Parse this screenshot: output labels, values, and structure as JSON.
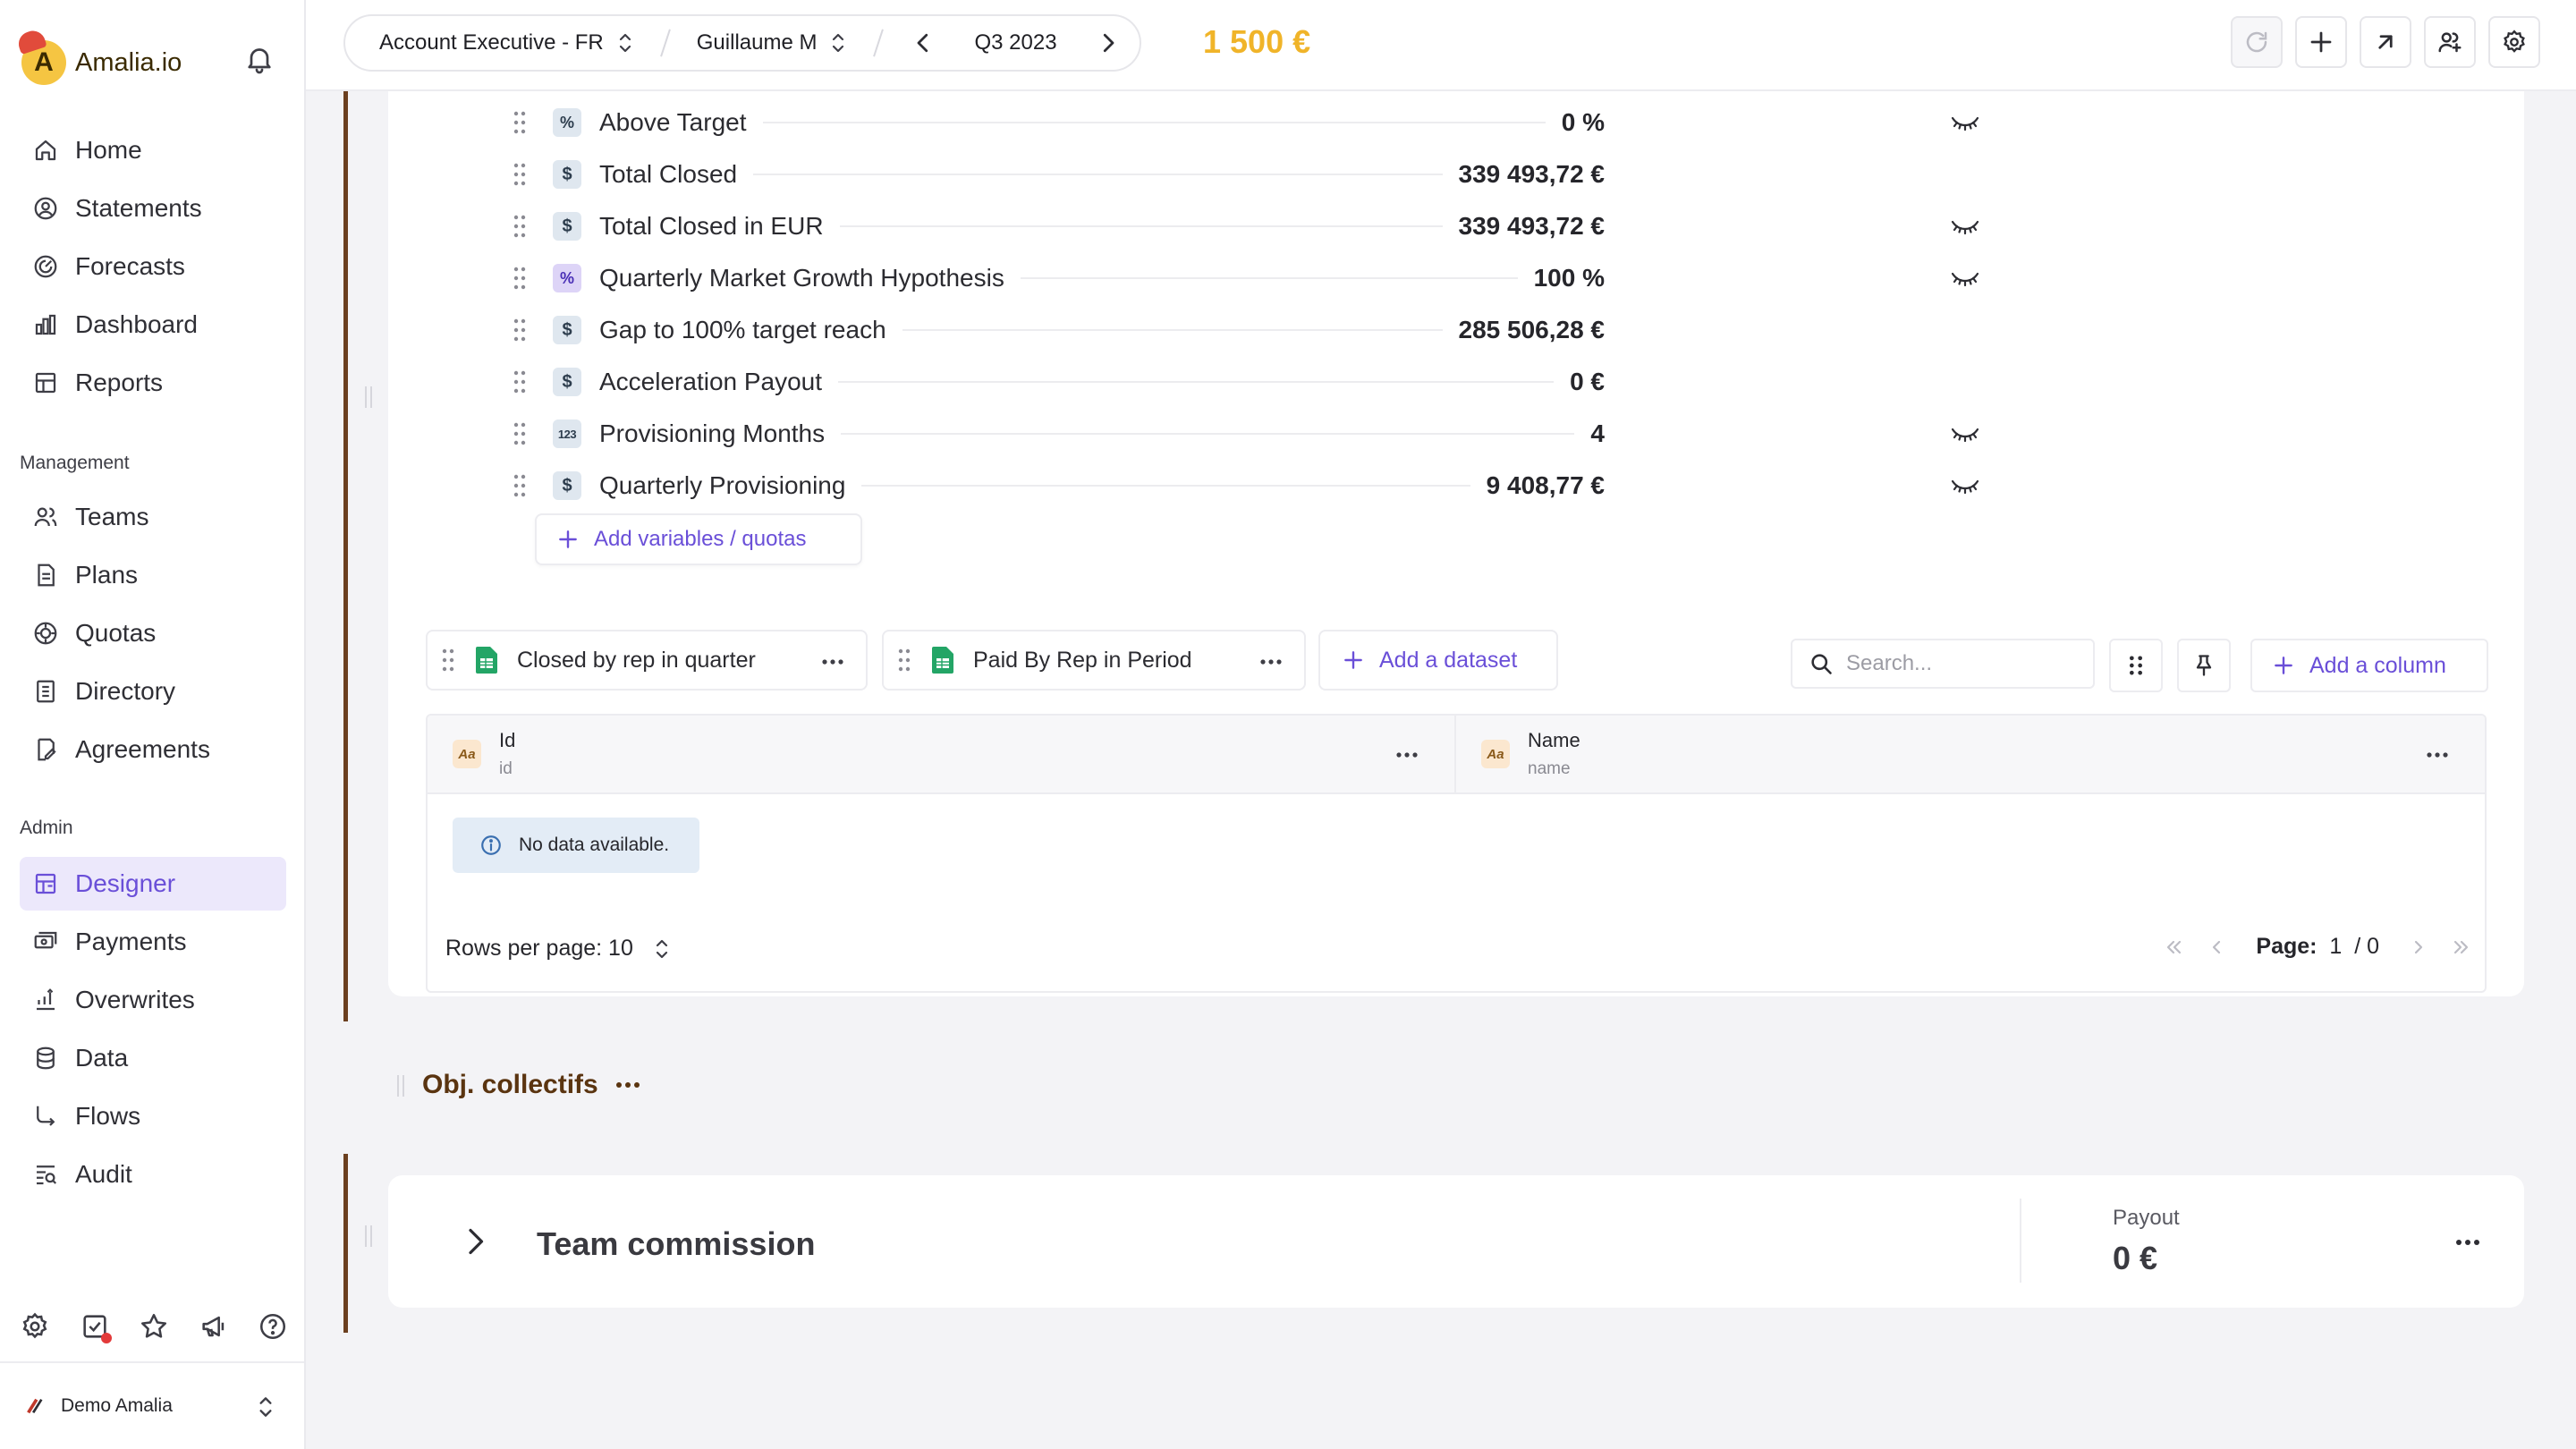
{
  "brand": {
    "name": "Amalia.io",
    "logo_letter": "A"
  },
  "sidebar": {
    "main_items": [
      {
        "label": "Home",
        "icon": "home-icon"
      },
      {
        "label": "Statements",
        "icon": "user-circle-icon"
      },
      {
        "label": "Forecasts",
        "icon": "forecast-icon"
      },
      {
        "label": "Dashboard",
        "icon": "bar-chart-icon"
      },
      {
        "label": "Reports",
        "icon": "table-icon"
      }
    ],
    "management_label": "Management",
    "management_items": [
      {
        "label": "Teams",
        "icon": "users-icon"
      },
      {
        "label": "Plans",
        "icon": "document-icon"
      },
      {
        "label": "Quotas",
        "icon": "target-icon"
      },
      {
        "label": "Directory",
        "icon": "directory-icon"
      },
      {
        "label": "Agreements",
        "icon": "signature-icon"
      }
    ],
    "admin_label": "Admin",
    "admin_items": [
      {
        "label": "Designer",
        "icon": "designer-icon",
        "active": true
      },
      {
        "label": "Payments",
        "icon": "payments-icon"
      },
      {
        "label": "Overwrites",
        "icon": "overwrites-icon"
      },
      {
        "label": "Data",
        "icon": "database-icon"
      },
      {
        "label": "Flows",
        "icon": "flows-icon"
      },
      {
        "label": "Audit",
        "icon": "audit-icon"
      }
    ],
    "user_name": "Demo Amalia"
  },
  "topbar": {
    "plan": "Account Executive - FR",
    "user": "Guillaume M",
    "period": "Q3 2023",
    "amount": "1 500 €"
  },
  "variables": [
    {
      "badge": "%",
      "name": "Above Target",
      "value": "0 %",
      "hidden": true
    },
    {
      "badge": "$",
      "name": "Total Closed",
      "value": "339 493,72 €",
      "hidden": false
    },
    {
      "badge": "$",
      "name": "Total Closed in EUR",
      "value": "339 493,72 €",
      "hidden": true
    },
    {
      "badge": "%",
      "name": "Quarterly Market Growth Hypothesis",
      "value": "100 %",
      "hidden": true,
      "purple": true
    },
    {
      "badge": "$",
      "name": "Gap to 100% target reach",
      "value": "285 506,28 €",
      "hidden": false
    },
    {
      "badge": "$",
      "name": "Acceleration Payout",
      "value": "0 €",
      "hidden": false
    },
    {
      "badge": "123",
      "name": "Provisioning Months",
      "value": "4",
      "hidden": true
    },
    {
      "badge": "$",
      "name": "Quarterly Provisioning",
      "value": "9 408,77 €",
      "hidden": true
    }
  ],
  "add_variables_label": "Add variables / quotas",
  "datasets": {
    "tabs": [
      "Closed by rep in quarter",
      "Paid By Rep in Period"
    ],
    "add_label": "Add a dataset",
    "search_placeholder": "Search...",
    "add_column_label": "Add a column",
    "columns": [
      {
        "label": "Id",
        "sub": "id"
      },
      {
        "label": "Name",
        "sub": "name"
      }
    ],
    "empty_message": "No data available.",
    "rows_per_page_label": "Rows per page: 10",
    "page_label": "Page:",
    "page_current": "1",
    "page_total": "/ 0"
  },
  "section": {
    "title": "Obj. collectifs",
    "rule_name": "Team commission",
    "payout_label": "Payout",
    "payout_value": "0 €"
  },
  "colors": {
    "accent": "#6a4fd8",
    "amount": "#f0b429",
    "section": "#5a3410"
  }
}
